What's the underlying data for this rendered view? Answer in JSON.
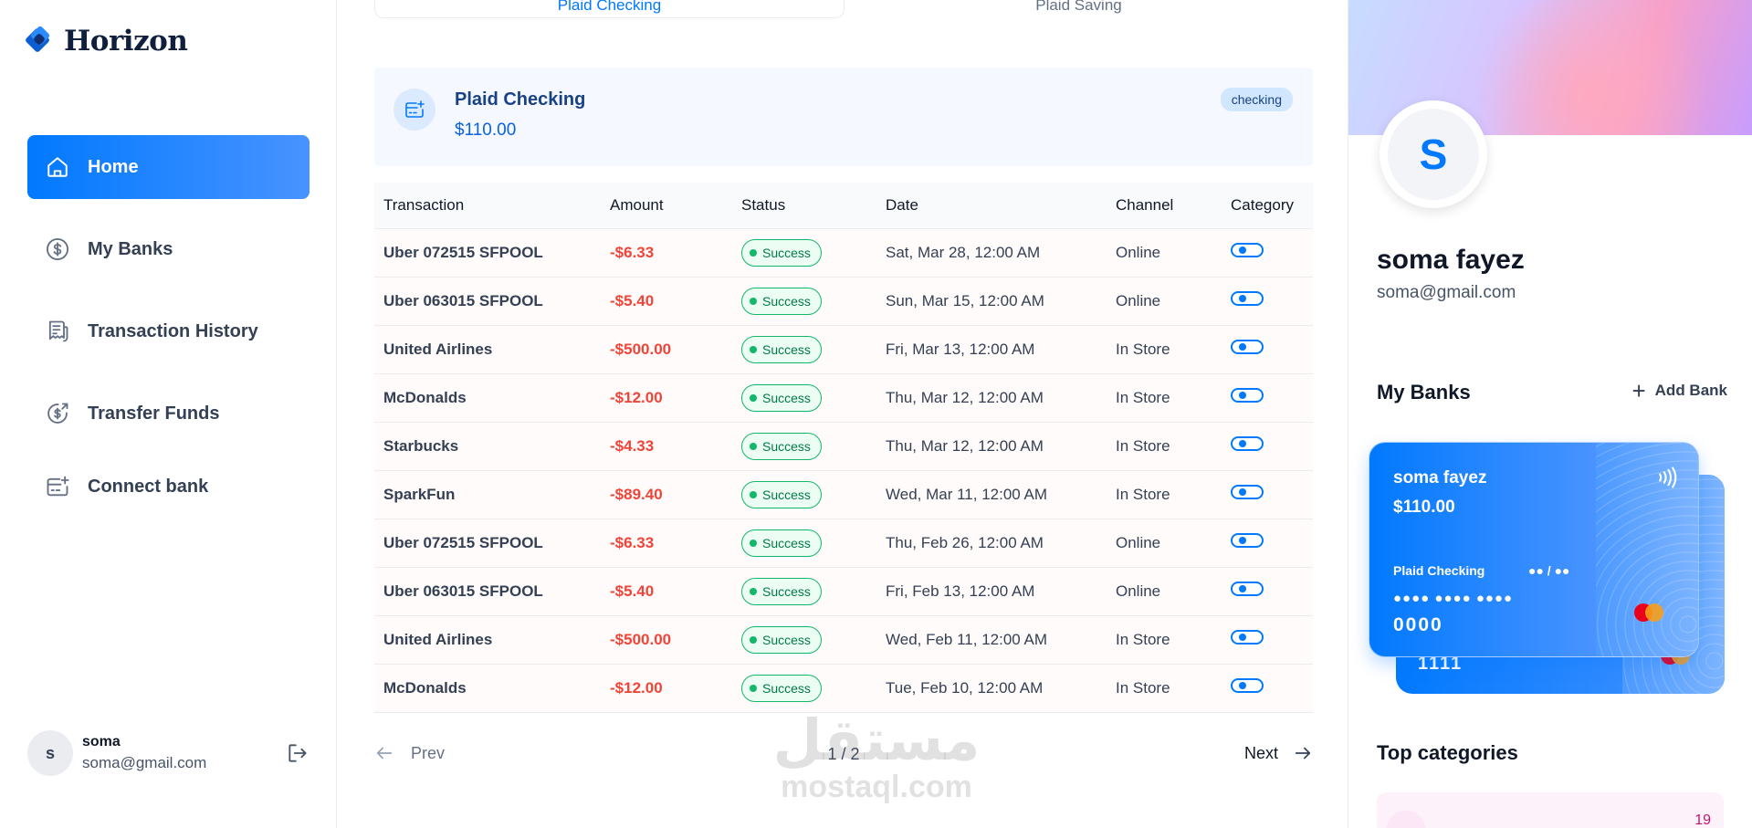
{
  "brand": {
    "name": "Horizon"
  },
  "nav": {
    "items": [
      {
        "label": "Home",
        "icon": "home-icon",
        "active": true
      },
      {
        "label": "My Banks",
        "icon": "dollar-circle-icon",
        "active": false
      },
      {
        "label": "Transaction History",
        "icon": "receipt-icon",
        "active": false
      },
      {
        "label": "Transfer Funds",
        "icon": "money-send-icon",
        "active": false
      },
      {
        "label": "Connect bank",
        "icon": "connect-bank-icon",
        "active": false
      }
    ]
  },
  "sidebar_user": {
    "initial": "s",
    "name": "soma",
    "email": "soma@gmail.com"
  },
  "tabs": [
    {
      "label": "Plaid Checking",
      "active": true
    },
    {
      "label": "Plaid Saving",
      "active": false
    }
  ],
  "account": {
    "name": "Plaid Checking",
    "balance": "$110.00",
    "type": "checking"
  },
  "table": {
    "headers": [
      "Transaction",
      "Amount",
      "Status",
      "Date",
      "Channel",
      "Category"
    ],
    "rows": [
      {
        "name": "Uber 072515 SFPOOL",
        "amount": "-$6.33",
        "status": "Success",
        "date": "Sat, Mar 28, 12:00 AM",
        "channel": "Online"
      },
      {
        "name": "Uber 063015 SFPOOL",
        "amount": "-$5.40",
        "status": "Success",
        "date": "Sun, Mar 15, 12:00 AM",
        "channel": "Online"
      },
      {
        "name": "United Airlines",
        "amount": "-$500.00",
        "status": "Success",
        "date": "Fri, Mar 13, 12:00 AM",
        "channel": "In Store"
      },
      {
        "name": "McDonalds",
        "amount": "-$12.00",
        "status": "Success",
        "date": "Thu, Mar 12, 12:00 AM",
        "channel": "In Store"
      },
      {
        "name": "Starbucks",
        "amount": "-$4.33",
        "status": "Success",
        "date": "Thu, Mar 12, 12:00 AM",
        "channel": "In Store"
      },
      {
        "name": "SparkFun",
        "amount": "-$89.40",
        "status": "Success",
        "date": "Wed, Mar 11, 12:00 AM",
        "channel": "In Store"
      },
      {
        "name": "Uber 072515 SFPOOL",
        "amount": "-$6.33",
        "status": "Success",
        "date": "Thu, Feb 26, 12:00 AM",
        "channel": "Online"
      },
      {
        "name": "Uber 063015 SFPOOL",
        "amount": "-$5.40",
        "status": "Success",
        "date": "Fri, Feb 13, 12:00 AM",
        "channel": "Online"
      },
      {
        "name": "United Airlines",
        "amount": "-$500.00",
        "status": "Success",
        "date": "Wed, Feb 11, 12:00 AM",
        "channel": "In Store"
      },
      {
        "name": "McDonalds",
        "amount": "-$12.00",
        "status": "Success",
        "date": "Tue, Feb 10, 12:00 AM",
        "channel": "In Store"
      }
    ]
  },
  "pagination": {
    "prev": "Prev",
    "next": "Next",
    "page": "1 / 2"
  },
  "watermark": {
    "arabic": "مستقل",
    "latin": "mostaql.com"
  },
  "profile": {
    "initial": "S",
    "name": "soma fayez",
    "email": "soma@gmail.com"
  },
  "my_banks": {
    "heading": "My Banks",
    "add_label": "Add Bank",
    "card": {
      "holder": "soma fayez",
      "balance": "$110.00",
      "bank": "Plaid Checking",
      "expiry": "●● / ●●",
      "mask": "●●●● ●●●● ●●●●",
      "last4": "0000"
    },
    "back_card": {
      "last4": "1111"
    }
  },
  "top_categories": {
    "heading": "Top categories",
    "first_count": "19"
  },
  "colors": {
    "accent": "#0179fe",
    "danger": "#f04438",
    "success": "#12b76a"
  }
}
